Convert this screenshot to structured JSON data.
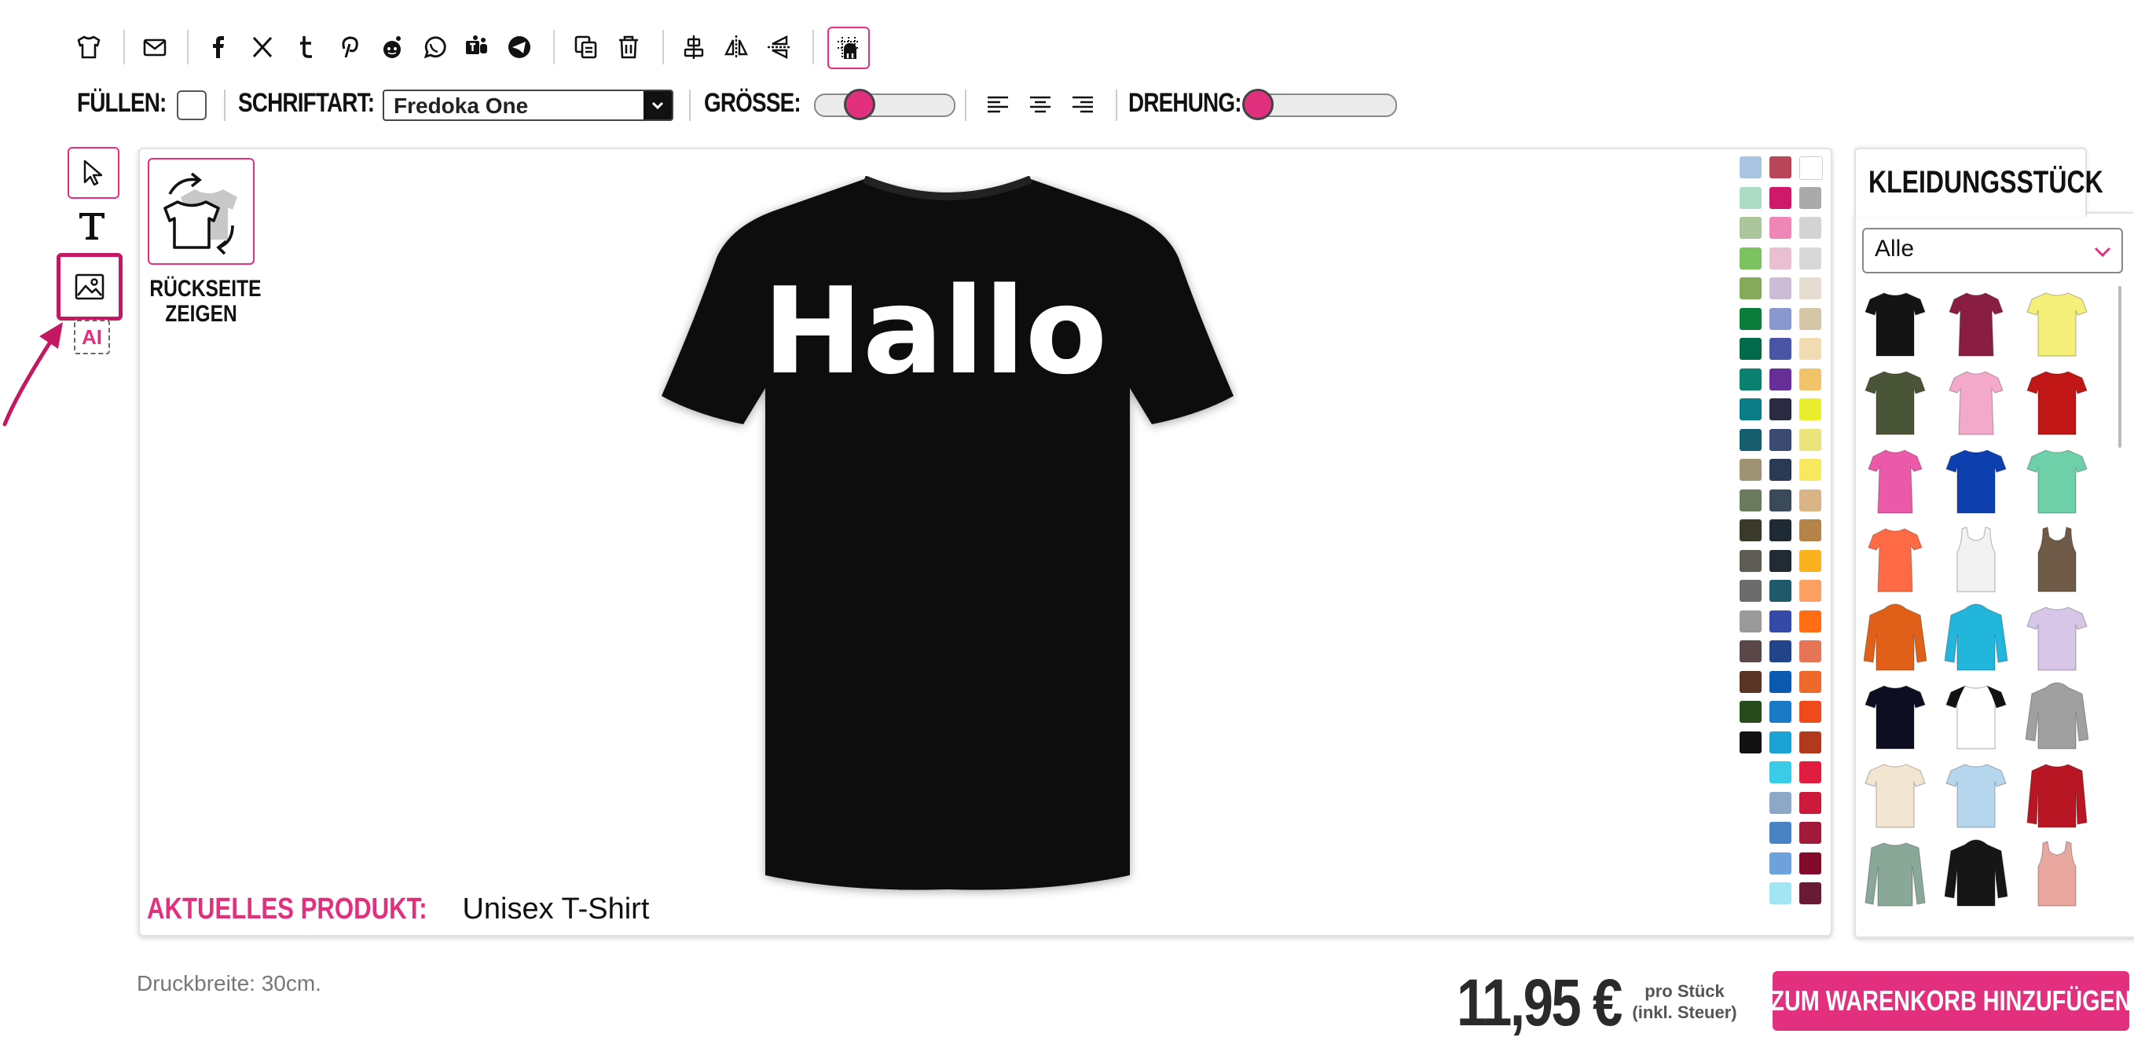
{
  "toolbar": {
    "icons": [
      "tshirt-icon",
      "mail-icon",
      "facebook-icon",
      "x-icon",
      "tumblr-icon",
      "pinterest-icon",
      "reddit-icon",
      "whatsapp-icon",
      "teams-icon",
      "telegram-icon",
      "duplicate-icon",
      "trash-icon",
      "align-center-icon",
      "flip-horizontal-icon",
      "flip-vertical-icon",
      "snap-grid-icon"
    ]
  },
  "options": {
    "fill_label": "FÜLLEN:",
    "font_label": "SCHRIFTART:",
    "font_value": "Fredoka One",
    "size_label": "GRÖSSE:",
    "size_level": 0.28,
    "rotation_label": "DREHUNG:",
    "rotation_level": 0.1
  },
  "tools": {
    "items": [
      "select-tool-icon",
      "text-tool-icon",
      "image-tool-icon",
      "ai-tool-icon"
    ],
    "ai_label": "AI"
  },
  "canvas": {
    "back_label_line1": "RÜCKSEITE",
    "back_label_line2": "ZEIGEN",
    "design_text": "Hallo",
    "product_key": "AKTUELLES PRODUKT:",
    "product_value": "Unisex T-Shirt"
  },
  "colors": {
    "accent": "#e2307f",
    "shirt": "#0d0d0d",
    "col1": [
      "#a9c4e0",
      "#acdcc4",
      "#aac69a",
      "#7dc261",
      "#84aa5a",
      "#0b7d3a",
      "#006a4a",
      "#0b8070",
      "#0a7d87",
      "#165e6e",
      "#9e9474",
      "#6a7a5c",
      "#3a3a2a",
      "#5d5d55",
      "#6c6c6c",
      "#9a9a9a",
      "#5a4848",
      "#5a3424",
      "#284a1c",
      "#111111"
    ],
    "col2": [
      "#b8455a",
      "#d0186a",
      "#ef86b7",
      "#eabfd2",
      "#cdbcd6",
      "#8a98d0",
      "#4b55a5",
      "#662e96",
      "#2a2a42",
      "#3a4a72",
      "#2a3a52",
      "#3a4a5a",
      "#1e2a34",
      "#222a34",
      "#1e5a6a",
      "#354aa6",
      "#22448a",
      "#0a5ab2",
      "#1a7ac6",
      "#1ca3d6",
      "#3acbe8",
      "#8ca8c6",
      "#4a82c6",
      "#6ea2dc",
      "#a2e6f4"
    ],
    "col3": [
      "#ffffff",
      "#aaaaaa",
      "#d3d3d3",
      "#d8d8d8",
      "#e6ddd0",
      "#d6c6a8",
      "#f0dcb0",
      "#f2c46a",
      "#e8ee2c",
      "#ebe47a",
      "#f8e860",
      "#d8b486",
      "#b4844a",
      "#fab220",
      "#fca062",
      "#ff6e14",
      "#e67456",
      "#ee6a2a",
      "#ee4a1c",
      "#b23a1c",
      "#e21c3e",
      "#cc1a3a",
      "#a01a3a",
      "#820a2a",
      "#6a1a32"
    ]
  },
  "panel": {
    "tab_label": "KLEIDUNGSSTÜCK",
    "category_value": "Alle",
    "garments": [
      {
        "type": "tee",
        "color": "#141414"
      },
      {
        "type": "tee-w",
        "color": "#8a1e42"
      },
      {
        "type": "tee",
        "color": "#f5f07a"
      },
      {
        "type": "tee",
        "color": "#4a5436"
      },
      {
        "type": "tee-w",
        "color": "#f3a9c9"
      },
      {
        "type": "tee",
        "color": "#c01616"
      },
      {
        "type": "tee-w",
        "color": "#ea5aa8"
      },
      {
        "type": "tee",
        "color": "#0e3fae"
      },
      {
        "type": "tee",
        "color": "#6ed0a8"
      },
      {
        "type": "tee-w",
        "color": "#ff6a46"
      },
      {
        "type": "tank",
        "color": "#f2f2f2"
      },
      {
        "type": "tank",
        "color": "#6e5a46"
      },
      {
        "type": "hoodie",
        "color": "#e0601a"
      },
      {
        "type": "hoodie",
        "color": "#22b6dc"
      },
      {
        "type": "tee",
        "color": "#d8c6e8"
      },
      {
        "type": "tee",
        "color": "#0e0e22"
      },
      {
        "type": "raglan",
        "color": "#ffffff"
      },
      {
        "type": "hoodie",
        "color": "#a0a0a0"
      },
      {
        "type": "tee",
        "color": "#f2e6d2"
      },
      {
        "type": "tee",
        "color": "#b6d6ee"
      },
      {
        "type": "jacket",
        "color": "#b81622"
      },
      {
        "type": "longsleeve",
        "color": "#8aa898"
      },
      {
        "type": "hoodie",
        "color": "#161616"
      },
      {
        "type": "tank",
        "color": "#e8a8a0"
      }
    ]
  },
  "footer": {
    "print_width": "Druckbreite: 30cm.",
    "price": "11,95 €",
    "per_piece_line1": "pro Stück",
    "per_piece_line2": "(inkl. Steuer)",
    "cart_label": "ZUM WARENKORB HINZUFÜGEN"
  }
}
